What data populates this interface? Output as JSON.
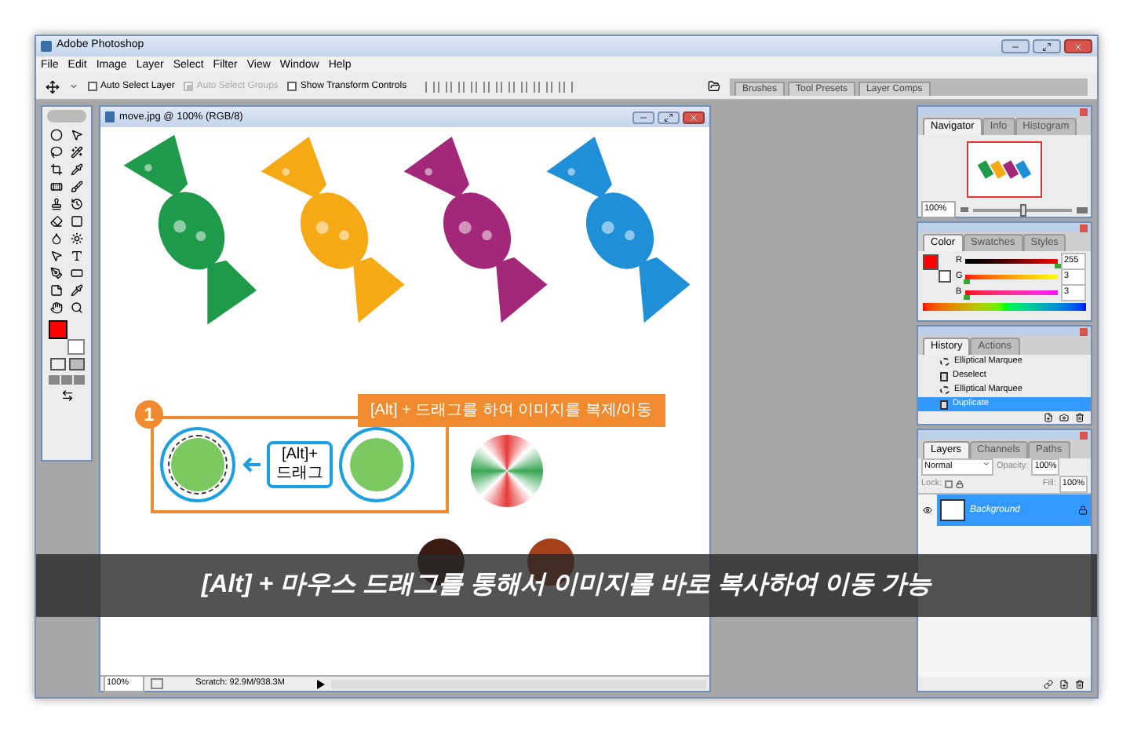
{
  "window": {
    "title": "Adobe Photoshop"
  },
  "menu": [
    "File",
    "Edit",
    "Image",
    "Layer",
    "Select",
    "Filter",
    "View",
    "Window",
    "Help"
  ],
  "options_bar": {
    "checkboxes": [
      {
        "label": "Auto Select Layer",
        "checked": false,
        "disabled": false
      },
      {
        "label": "Auto Select Groups",
        "checked": true,
        "disabled": true
      },
      {
        "label": "Show Transform Controls",
        "checked": false,
        "disabled": false
      }
    ],
    "palette_well": [
      "Brushes",
      "Tool Presets",
      "Layer Comps"
    ]
  },
  "document": {
    "title": "move.jpg @ 100% (RGB/8)",
    "zoom": "100%",
    "status": "Scratch: 92.9M/938.3M",
    "annotation": {
      "step": "1",
      "callout": "[Alt] + 드래그를 하여 이미지를 복제/이동",
      "label_lines": [
        "[Alt]+",
        "드래그"
      ]
    }
  },
  "caption": "[Alt] + 마우스 드래그를 통해서 이미지를 바로 복사하여 이동 가능",
  "navigator": {
    "tabs": [
      {
        "label": "Navigator",
        "selected": true
      },
      {
        "label": "Info",
        "selected": false
      },
      {
        "label": "Histogram",
        "selected": false
      }
    ],
    "zoom": "100%",
    "level": 0.5
  },
  "color": {
    "tabs": [
      {
        "label": "Color",
        "selected": true
      },
      {
        "label": "Swatches",
        "selected": false
      },
      {
        "label": "Styles",
        "selected": false
      }
    ],
    "channels": [
      {
        "name": "R",
        "value": "255",
        "level": 1
      },
      {
        "name": "G",
        "value": "3",
        "level": 0.01
      },
      {
        "name": "B",
        "value": "3",
        "level": 0.01
      }
    ]
  },
  "history": {
    "tabs": [
      {
        "label": "History",
        "selected": true
      },
      {
        "label": "Actions",
        "selected": false
      }
    ],
    "items": [
      {
        "label": "Elliptical Marquee",
        "kind": "marquee",
        "selected": false
      },
      {
        "label": "Deselect",
        "kind": "doc",
        "selected": false
      },
      {
        "label": "Elliptical Marquee",
        "kind": "marquee",
        "selected": false
      },
      {
        "label": "Duplicate",
        "kind": "doc",
        "selected": true
      }
    ]
  },
  "layers": {
    "tabs": [
      {
        "label": "Layers",
        "selected": true
      },
      {
        "label": "Channels",
        "selected": false
      },
      {
        "label": "Paths",
        "selected": false
      }
    ],
    "blend_mode": "Normal",
    "opacity_label": "Opacity:",
    "opacity": "100%",
    "lock_label": "Lock:",
    "fill_label": "Fill:",
    "fill": "100%",
    "items": [
      {
        "name": "Background",
        "selected": true,
        "visible": true,
        "locked": true
      }
    ]
  }
}
